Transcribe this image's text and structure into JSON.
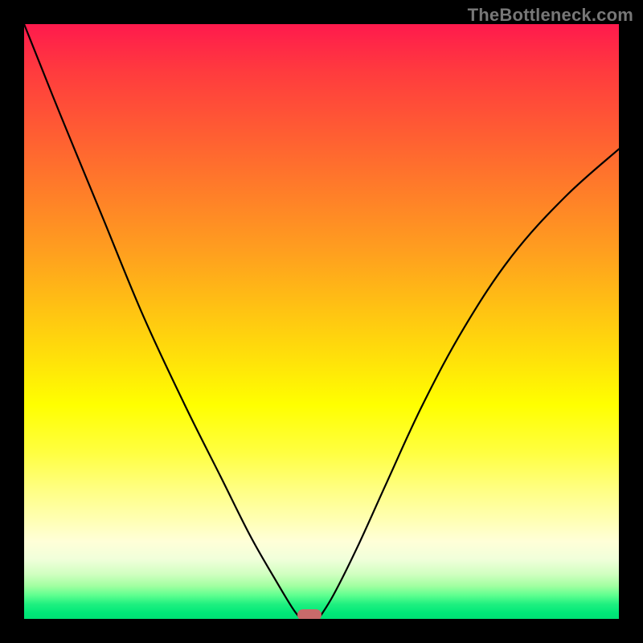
{
  "watermark": "TheBottleneck.com",
  "chart_data": {
    "type": "line",
    "title": "",
    "xlabel": "",
    "ylabel": "",
    "xlim": [
      0,
      100
    ],
    "ylim": [
      0,
      100
    ],
    "grid": false,
    "legend": false,
    "gradient_stops": [
      {
        "pos": 0,
        "color": "#ff1a4d"
      },
      {
        "pos": 18,
        "color": "#ff5c33"
      },
      {
        "pos": 38,
        "color": "#ff9e1f"
      },
      {
        "pos": 56,
        "color": "#ffe00a"
      },
      {
        "pos": 72,
        "color": "#ffff40"
      },
      {
        "pos": 87,
        "color": "#ffffd8"
      },
      {
        "pos": 96,
        "color": "#60ff90"
      },
      {
        "pos": 100,
        "color": "#00e074"
      }
    ],
    "series": [
      {
        "name": "left-branch",
        "x": [
          0,
          6,
          13,
          20,
          27,
          33,
          38,
          42,
          45,
          46.5
        ],
        "values": [
          100,
          85,
          68,
          51,
          36,
          24,
          14,
          7,
          2,
          0
        ]
      },
      {
        "name": "right-branch",
        "x": [
          49.5,
          52,
          56,
          61,
          67,
          74,
          82,
          91,
          100
        ],
        "values": [
          0,
          4,
          12,
          23,
          36,
          49,
          61,
          71,
          79
        ]
      }
    ],
    "bottleneck_marker": {
      "x_center": 48,
      "width": 4,
      "y": 0,
      "color": "#c96a6a"
    }
  }
}
